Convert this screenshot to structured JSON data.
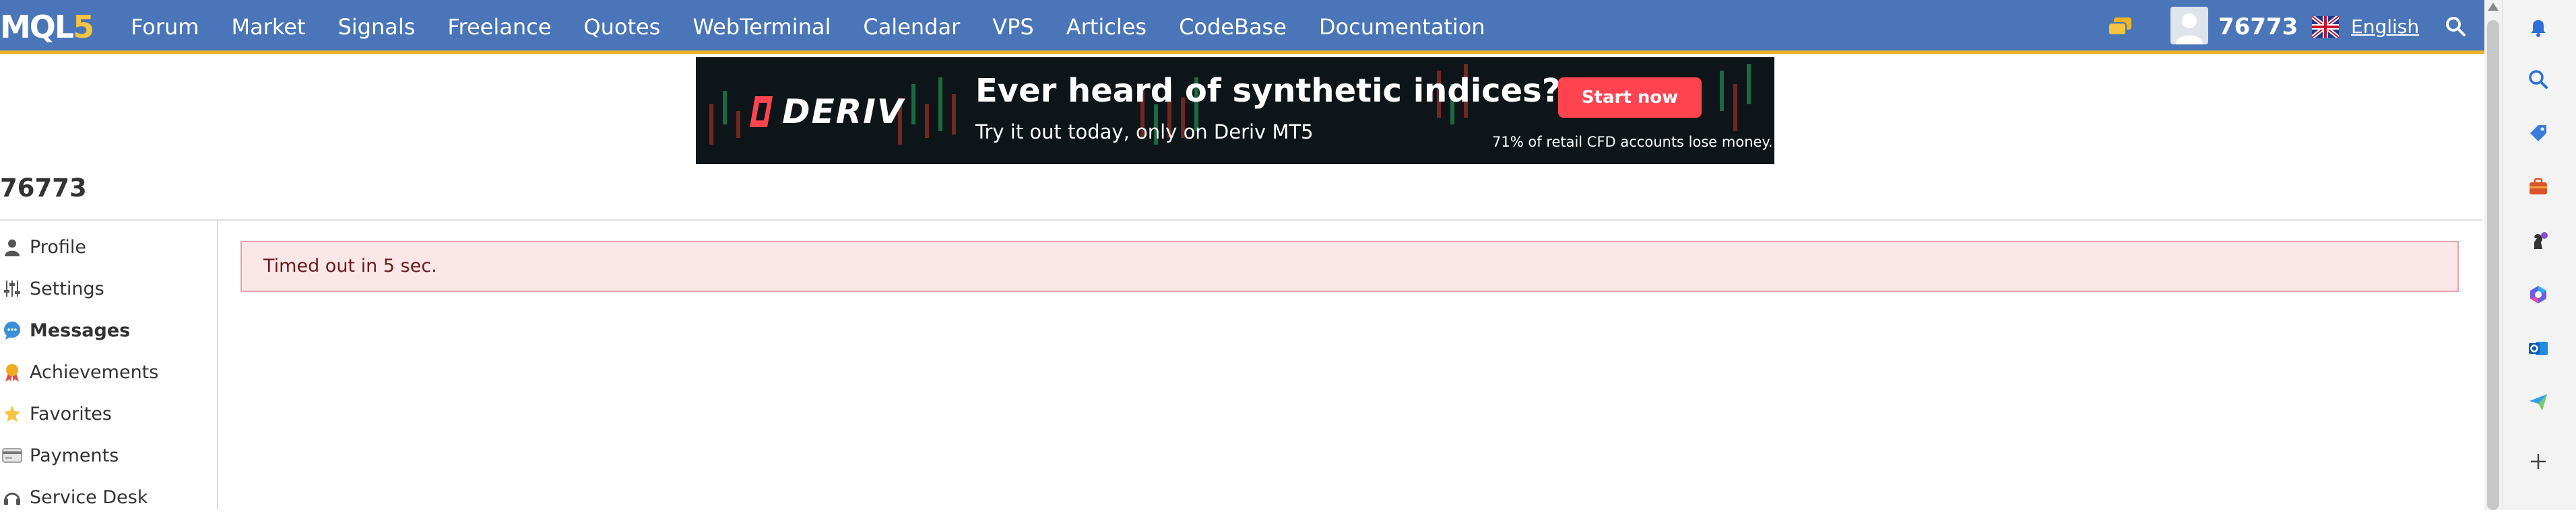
{
  "nav": {
    "logo_main": "MQL",
    "logo_num": "5",
    "links": [
      "Forum",
      "Market",
      "Signals",
      "Freelance",
      "Quotes",
      "WebTerminal",
      "Calendar",
      "VPS",
      "Articles",
      "CodeBase",
      "Documentation"
    ],
    "username": "76773",
    "language": "English",
    "icons": {
      "chat": "chat-icon",
      "search": "search-icon",
      "flag": "uk-flag-icon"
    }
  },
  "banner": {
    "brand": "DERIV",
    "headline": "Ever heard of synthetic indices?",
    "subline": "Try it out today, only on Deriv MT5",
    "cta": "Start now",
    "disclaimer": "71% of retail CFD accounts lose money.",
    "cta_color": "#ff444f"
  },
  "page": {
    "title": "76773",
    "alert": "Timed out in 5 sec."
  },
  "sidebar": {
    "items": [
      {
        "label": "Profile",
        "icon": "user-icon",
        "active": false
      },
      {
        "label": "Settings",
        "icon": "sliders-icon",
        "active": false
      },
      {
        "label": "Messages",
        "icon": "chat-bubble-icon",
        "active": true
      },
      {
        "label": "Achievements",
        "icon": "medal-icon",
        "active": false
      },
      {
        "label": "Favorites",
        "icon": "star-icon",
        "active": false
      },
      {
        "label": "Payments",
        "icon": "card-icon",
        "active": false
      },
      {
        "label": "Service Desk",
        "icon": "headset-icon",
        "active": false
      }
    ]
  },
  "browser_sidebar": {
    "icons": [
      "bell-icon",
      "search-icon",
      "tag-icon",
      "briefcase-icon",
      "chess-icon",
      "copilot-icon",
      "outlook-icon",
      "send-icon",
      "plus-icon"
    ]
  },
  "colors": {
    "nav_bg": "#4a76b9",
    "nav_accent": "#e7b22d",
    "alert_bg": "#fce7e8",
    "alert_border": "#e5a4a9"
  }
}
